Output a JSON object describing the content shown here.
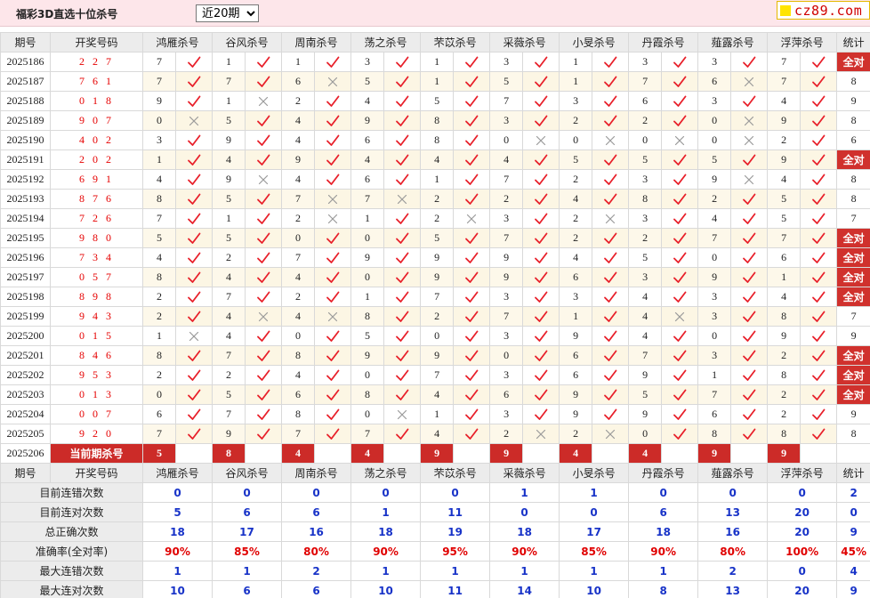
{
  "title": "福彩3D直选十位杀号",
  "period_select": {
    "selected": "近20期",
    "options": [
      "近20期"
    ]
  },
  "logo": {
    "text": "cz89.com"
  },
  "header": {
    "period": "期号",
    "numbers": "开奖号码",
    "experts": [
      "鸿雁杀号",
      "谷风杀号",
      "周南杀号",
      "荡之杀号",
      "芣苡杀号",
      "采薇杀号",
      "小旻杀号",
      "丹霞杀号",
      "薤露杀号",
      "浮萍杀号"
    ],
    "stat": "统计"
  },
  "rows": [
    {
      "period": "2025186",
      "nums": "2 2 7",
      "kills": [
        7,
        1,
        1,
        3,
        1,
        3,
        1,
        3,
        3,
        7
      ],
      "ok": [
        1,
        1,
        1,
        1,
        1,
        1,
        1,
        1,
        1,
        1
      ],
      "stat": "全对"
    },
    {
      "period": "2025187",
      "nums": "7 6 1",
      "kills": [
        7,
        7,
        6,
        5,
        1,
        5,
        1,
        7,
        6,
        7
      ],
      "ok": [
        1,
        1,
        0,
        1,
        1,
        1,
        1,
        1,
        0,
        1
      ],
      "stat": "8"
    },
    {
      "period": "2025188",
      "nums": "0 1 8",
      "kills": [
        9,
        1,
        2,
        4,
        5,
        7,
        3,
        6,
        3,
        4
      ],
      "ok": [
        1,
        0,
        1,
        1,
        1,
        1,
        1,
        1,
        1,
        1
      ],
      "stat": "9"
    },
    {
      "period": "2025189",
      "nums": "9 0 7",
      "kills": [
        0,
        5,
        4,
        9,
        8,
        3,
        2,
        2,
        0,
        9
      ],
      "ok": [
        0,
        1,
        1,
        1,
        1,
        1,
        1,
        1,
        0,
        1
      ],
      "stat": "8"
    },
    {
      "period": "2025190",
      "nums": "4 0 2",
      "kills": [
        3,
        9,
        4,
        6,
        8,
        0,
        0,
        0,
        0,
        2
      ],
      "ok": [
        1,
        1,
        1,
        1,
        1,
        0,
        0,
        0,
        0,
        1
      ],
      "stat": "6"
    },
    {
      "period": "2025191",
      "nums": "2 0 2",
      "kills": [
        1,
        4,
        9,
        4,
        4,
        4,
        5,
        5,
        5,
        9
      ],
      "ok": [
        1,
        1,
        1,
        1,
        1,
        1,
        1,
        1,
        1,
        1
      ],
      "stat": "全对"
    },
    {
      "period": "2025192",
      "nums": "6 9 1",
      "kills": [
        4,
        9,
        4,
        6,
        1,
        7,
        2,
        3,
        9,
        4
      ],
      "ok": [
        1,
        0,
        1,
        1,
        1,
        1,
        1,
        1,
        0,
        1
      ],
      "stat": "8"
    },
    {
      "period": "2025193",
      "nums": "8 7 6",
      "kills": [
        8,
        5,
        7,
        7,
        2,
        2,
        4,
        8,
        2,
        5
      ],
      "ok": [
        1,
        1,
        0,
        0,
        1,
        1,
        1,
        1,
        1,
        1
      ],
      "stat": "8"
    },
    {
      "period": "2025194",
      "nums": "7 2 6",
      "kills": [
        7,
        1,
        2,
        1,
        2,
        3,
        2,
        3,
        4,
        5
      ],
      "ok": [
        1,
        1,
        0,
        1,
        0,
        1,
        0,
        1,
        1,
        1
      ],
      "stat": "7"
    },
    {
      "period": "2025195",
      "nums": "9 8 0",
      "kills": [
        5,
        5,
        0,
        0,
        5,
        7,
        2,
        2,
        7,
        7
      ],
      "ok": [
        1,
        1,
        1,
        1,
        1,
        1,
        1,
        1,
        1,
        1
      ],
      "stat": "全对"
    },
    {
      "period": "2025196",
      "nums": "7 3 4",
      "kills": [
        4,
        2,
        7,
        9,
        9,
        9,
        4,
        5,
        0,
        6
      ],
      "ok": [
        1,
        1,
        1,
        1,
        1,
        1,
        1,
        1,
        1,
        1
      ],
      "stat": "全对"
    },
    {
      "period": "2025197",
      "nums": "0 5 7",
      "kills": [
        8,
        4,
        4,
        0,
        9,
        9,
        6,
        3,
        9,
        1
      ],
      "ok": [
        1,
        1,
        1,
        1,
        1,
        1,
        1,
        1,
        1,
        1
      ],
      "stat": "全对"
    },
    {
      "period": "2025198",
      "nums": "8 9 8",
      "kills": [
        2,
        7,
        2,
        1,
        7,
        3,
        3,
        4,
        3,
        4
      ],
      "ok": [
        1,
        1,
        1,
        1,
        1,
        1,
        1,
        1,
        1,
        1
      ],
      "stat": "全对"
    },
    {
      "period": "2025199",
      "nums": "9 4 3",
      "kills": [
        2,
        4,
        4,
        8,
        2,
        7,
        1,
        4,
        3,
        8
      ],
      "ok": [
        1,
        0,
        0,
        1,
        1,
        1,
        1,
        0,
        1,
        1
      ],
      "stat": "7"
    },
    {
      "period": "2025200",
      "nums": "0 1 5",
      "kills": [
        1,
        4,
        0,
        5,
        0,
        3,
        9,
        4,
        0,
        9
      ],
      "ok": [
        0,
        1,
        1,
        1,
        1,
        1,
        1,
        1,
        1,
        1
      ],
      "stat": "9"
    },
    {
      "period": "2025201",
      "nums": "8 4 6",
      "kills": [
        8,
        7,
        8,
        9,
        9,
        0,
        6,
        7,
        3,
        2
      ],
      "ok": [
        1,
        1,
        1,
        1,
        1,
        1,
        1,
        1,
        1,
        1
      ],
      "stat": "全对"
    },
    {
      "period": "2025202",
      "nums": "9 5 3",
      "kills": [
        2,
        2,
        4,
        0,
        7,
        3,
        6,
        9,
        1,
        8
      ],
      "ok": [
        1,
        1,
        1,
        1,
        1,
        1,
        1,
        1,
        1,
        1
      ],
      "stat": "全对"
    },
    {
      "period": "2025203",
      "nums": "0 1 3",
      "kills": [
        0,
        5,
        6,
        8,
        4,
        6,
        9,
        5,
        7,
        2
      ],
      "ok": [
        1,
        1,
        1,
        1,
        1,
        1,
        1,
        1,
        1,
        1
      ],
      "stat": "全对"
    },
    {
      "period": "2025204",
      "nums": "0 0 7",
      "kills": [
        6,
        7,
        8,
        0,
        1,
        3,
        9,
        9,
        6,
        2
      ],
      "ok": [
        1,
        1,
        1,
        0,
        1,
        1,
        1,
        1,
        1,
        1
      ],
      "stat": "9"
    },
    {
      "period": "2025205",
      "nums": "9 2 0",
      "kills": [
        7,
        9,
        7,
        7,
        4,
        2,
        2,
        0,
        8,
        8
      ],
      "ok": [
        1,
        1,
        1,
        1,
        1,
        0,
        0,
        1,
        1,
        1
      ],
      "stat": "8"
    }
  ],
  "current": {
    "period": "2025206",
    "label": "当前期杀号",
    "kills": [
      5,
      8,
      4,
      4,
      9,
      9,
      4,
      4,
      9,
      9
    ]
  },
  "header2": {
    "period": "期号",
    "numbers": "开奖号码",
    "experts": [
      "鸿雁杀号",
      "谷风杀号",
      "周南杀号",
      "荡之杀号",
      "芣苡杀号",
      "采薇杀号",
      "小旻杀号",
      "丹霞杀号",
      "薤露杀号",
      "浮萍杀号"
    ],
    "stat": "统计"
  },
  "summary": [
    {
      "label": "目前连错次数",
      "values": [
        "0",
        "0",
        "0",
        "0",
        "0",
        "1",
        "1",
        "0",
        "0",
        "0",
        "2"
      ],
      "kind": "num"
    },
    {
      "label": "目前连对次数",
      "values": [
        "5",
        "6",
        "6",
        "1",
        "11",
        "0",
        "0",
        "6",
        "13",
        "20",
        "0"
      ],
      "kind": "num"
    },
    {
      "label": "总正确次数",
      "values": [
        "18",
        "17",
        "16",
        "18",
        "19",
        "18",
        "17",
        "18",
        "16",
        "20",
        "9"
      ],
      "kind": "num"
    },
    {
      "label": "准确率(全对率)",
      "values": [
        "90%",
        "85%",
        "80%",
        "90%",
        "95%",
        "90%",
        "85%",
        "90%",
        "80%",
        "100%",
        "45%"
      ],
      "kind": "pct"
    },
    {
      "label": "最大连错次数",
      "values": [
        "1",
        "1",
        "2",
        "1",
        "1",
        "1",
        "1",
        "1",
        "2",
        "0",
        "4"
      ],
      "kind": "num"
    },
    {
      "label": "最大连对次数",
      "values": [
        "10",
        "6",
        "6",
        "10",
        "11",
        "14",
        "10",
        "8",
        "13",
        "20",
        "9"
      ],
      "kind": "num"
    }
  ],
  "icons": {
    "ok": "check-icon",
    "miss": "cross-icon"
  },
  "colors": {
    "accent_red": "#cc2b28",
    "check_red": "#e8202a",
    "cross_gray": "#9a9a9a",
    "summary_blue": "#1833c8",
    "header_bg": "#fde6ea"
  }
}
